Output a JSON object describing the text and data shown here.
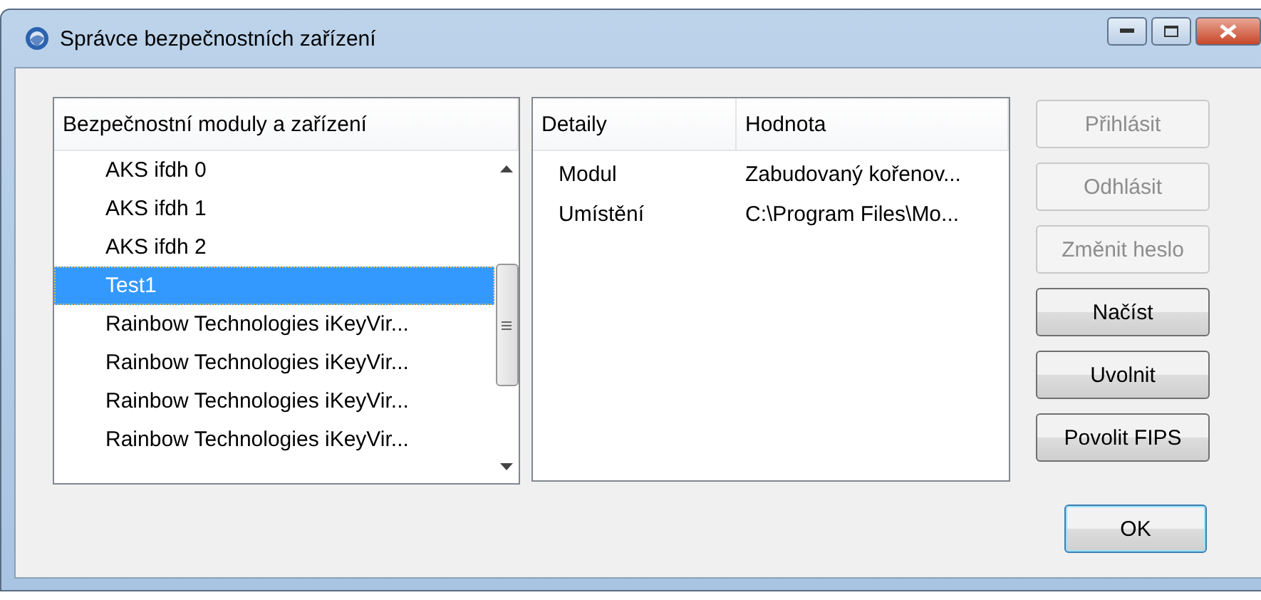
{
  "window": {
    "title": "Správce bezpečnostních zařízení"
  },
  "devices": {
    "header": "Bezpečnostní moduly a zařízení",
    "items": [
      {
        "label": "AKS ifdh 0",
        "selected": false
      },
      {
        "label": "AKS ifdh 1",
        "selected": false
      },
      {
        "label": "AKS ifdh 2",
        "selected": false
      },
      {
        "label": "Test1",
        "selected": true
      },
      {
        "label": "Rainbow Technologies iKeyVir...",
        "selected": false
      },
      {
        "label": "Rainbow Technologies iKeyVir...",
        "selected": false
      },
      {
        "label": "Rainbow Technologies iKeyVir...",
        "selected": false
      },
      {
        "label": "Rainbow Technologies iKeyVir...",
        "selected": false
      }
    ]
  },
  "details": {
    "columns": [
      "Detaily",
      "Hodnota"
    ],
    "rows": [
      [
        "Modul",
        "Zabudovaný kořenov..."
      ],
      [
        "Umístění",
        "C:\\Program Files\\Mo..."
      ]
    ]
  },
  "buttons": [
    {
      "label": "Přihlásit",
      "disabled": true
    },
    {
      "label": "Odhlásit",
      "disabled": true
    },
    {
      "label": "Změnit heslo",
      "disabled": true
    },
    {
      "label": "Načíst",
      "disabled": false
    },
    {
      "label": "Uvolnit",
      "disabled": false
    },
    {
      "label": "Povolit FIPS",
      "disabled": false
    }
  ],
  "ok_button": "OK"
}
